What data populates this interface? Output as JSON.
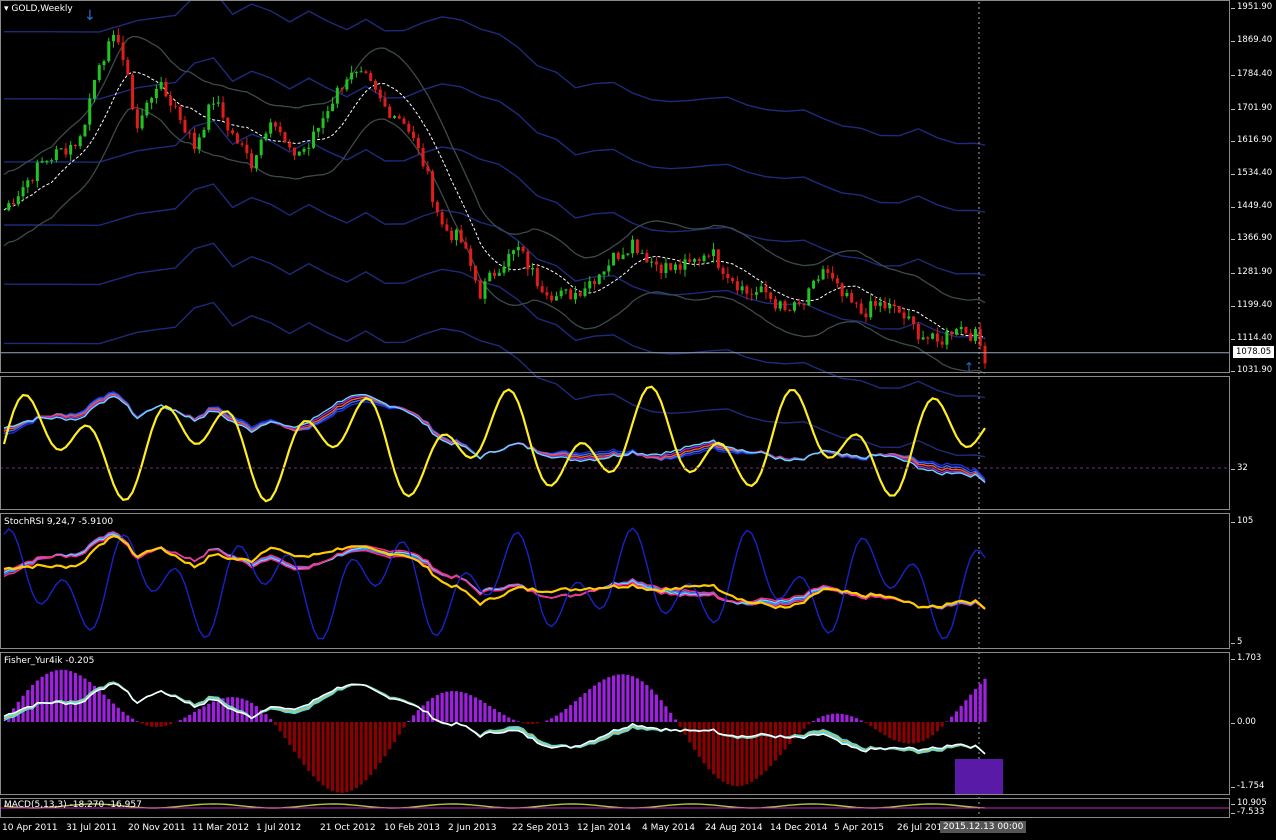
{
  "chart_data": [
    {
      "type": "candlestick",
      "pane_title": "GOLD,Weekly",
      "symbol": "GOLD",
      "timeframe": "Weekly",
      "y_ticks": [
        "1951.90",
        "1869.40",
        "1784.40",
        "1701.90",
        "1616.90",
        "1534.40",
        "1449.40",
        "1366.90",
        "1281.90",
        "1199.40",
        "1114.40",
        "1031.90"
      ],
      "ylim": [
        1031.9,
        1951.9
      ],
      "current_price": "1078.05",
      "x_ticks": [
        "10 Apr 2011",
        "31 Jul 2011",
        "20 Nov 2011",
        "11 Mar 2012",
        "1 Jul 2012",
        "21 Oct 2012",
        "10 Feb 2013",
        "2 Jun 2013",
        "22 Sep 2013",
        "12 Jan 2014",
        "4 May 2014",
        "24 Aug 2014",
        "14 Dec 2014",
        "5 Apr 2015",
        "26 Jul 2015"
      ],
      "cursor_time": "2015.12.13 00:00",
      "price_path": [
        [
          0,
          1440
        ],
        [
          8,
          1560
        ],
        [
          16,
          1620
        ],
        [
          20,
          1820
        ],
        [
          24,
          1880
        ],
        [
          28,
          1650
        ],
        [
          32,
          1760
        ],
        [
          36,
          1700
        ],
        [
          40,
          1600
        ],
        [
          44,
          1720
        ],
        [
          48,
          1630
        ],
        [
          52,
          1560
        ],
        [
          56,
          1680
        ],
        [
          60,
          1580
        ],
        [
          64,
          1600
        ],
        [
          68,
          1700
        ],
        [
          72,
          1780
        ],
        [
          76,
          1770
        ],
        [
          80,
          1700
        ],
        [
          84,
          1670
        ],
        [
          88,
          1560
        ],
        [
          92,
          1400
        ],
        [
          96,
          1360
        ],
        [
          100,
          1230
        ],
        [
          104,
          1300
        ],
        [
          108,
          1340
        ],
        [
          112,
          1260
        ],
        [
          116,
          1220
        ],
        [
          120,
          1230
        ],
        [
          124,
          1270
        ],
        [
          128,
          1320
        ],
        [
          132,
          1360
        ],
        [
          136,
          1310
        ],
        [
          140,
          1290
        ],
        [
          144,
          1300
        ],
        [
          148,
          1340
        ],
        [
          152,
          1280
        ],
        [
          156,
          1230
        ],
        [
          160,
          1230
        ],
        [
          164,
          1180
        ],
        [
          168,
          1200
        ],
        [
          172,
          1290
        ],
        [
          176,
          1220
        ],
        [
          180,
          1180
        ],
        [
          184,
          1200
        ],
        [
          188,
          1180
        ],
        [
          192,
          1130
        ],
        [
          196,
          1100
        ],
        [
          200,
          1150
        ],
        [
          204,
          1120
        ],
        [
          206,
          1070
        ]
      ]
    },
    {
      "type": "line",
      "pane_title": "",
      "y_ticks": [
        "32"
      ],
      "level_line": 32
    },
    {
      "type": "line",
      "pane_title": "StochRSI 9,24,7 -5.9100",
      "y_ticks": [
        "105",
        "5"
      ]
    },
    {
      "type": "histogram",
      "pane_title": "Fisher_Yur4ik -0.205",
      "y_ticks": [
        "1.703",
        "0.00",
        "-1.754"
      ],
      "ylim": [
        -1.754,
        1.703
      ]
    },
    {
      "type": "line",
      "pane_title": "MACD(5,13,3) -18.270 -16.957",
      "y_ticks": [
        "10.905",
        "-7.533"
      ]
    }
  ]
}
